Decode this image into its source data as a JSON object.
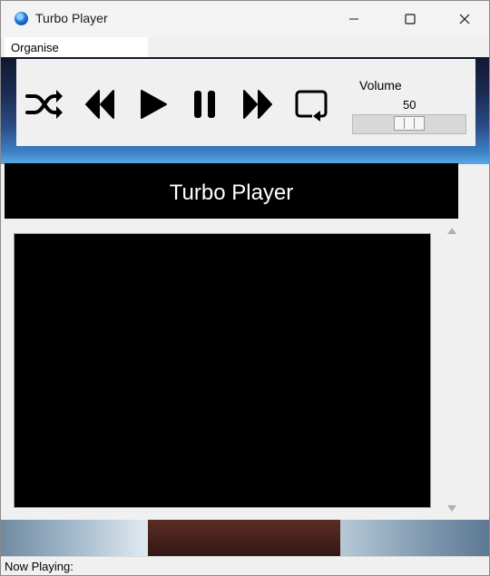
{
  "window": {
    "title": "Turbo Player",
    "controls": [
      "minimize",
      "maximize",
      "close"
    ]
  },
  "menu": {
    "items": [
      {
        "label": "Organise"
      }
    ]
  },
  "toolbar": {
    "buttons": [
      {
        "name": "shuffle",
        "icon": "shuffle-icon"
      },
      {
        "name": "previous",
        "icon": "rewind-icon"
      },
      {
        "name": "play",
        "icon": "play-icon"
      },
      {
        "name": "pause",
        "icon": "pause-icon"
      },
      {
        "name": "next",
        "icon": "fast-forward-icon"
      },
      {
        "name": "repeat",
        "icon": "repeat-icon"
      }
    ]
  },
  "volume": {
    "label": "Volume",
    "value": "50",
    "level": 0.5
  },
  "banner": {
    "title": "Turbo Player"
  },
  "status": {
    "now_playing": "Now Playing:"
  },
  "colors": {
    "banner_background": "#000000",
    "banner_text": "#ffffff",
    "window_background": "#f0f0f0"
  }
}
